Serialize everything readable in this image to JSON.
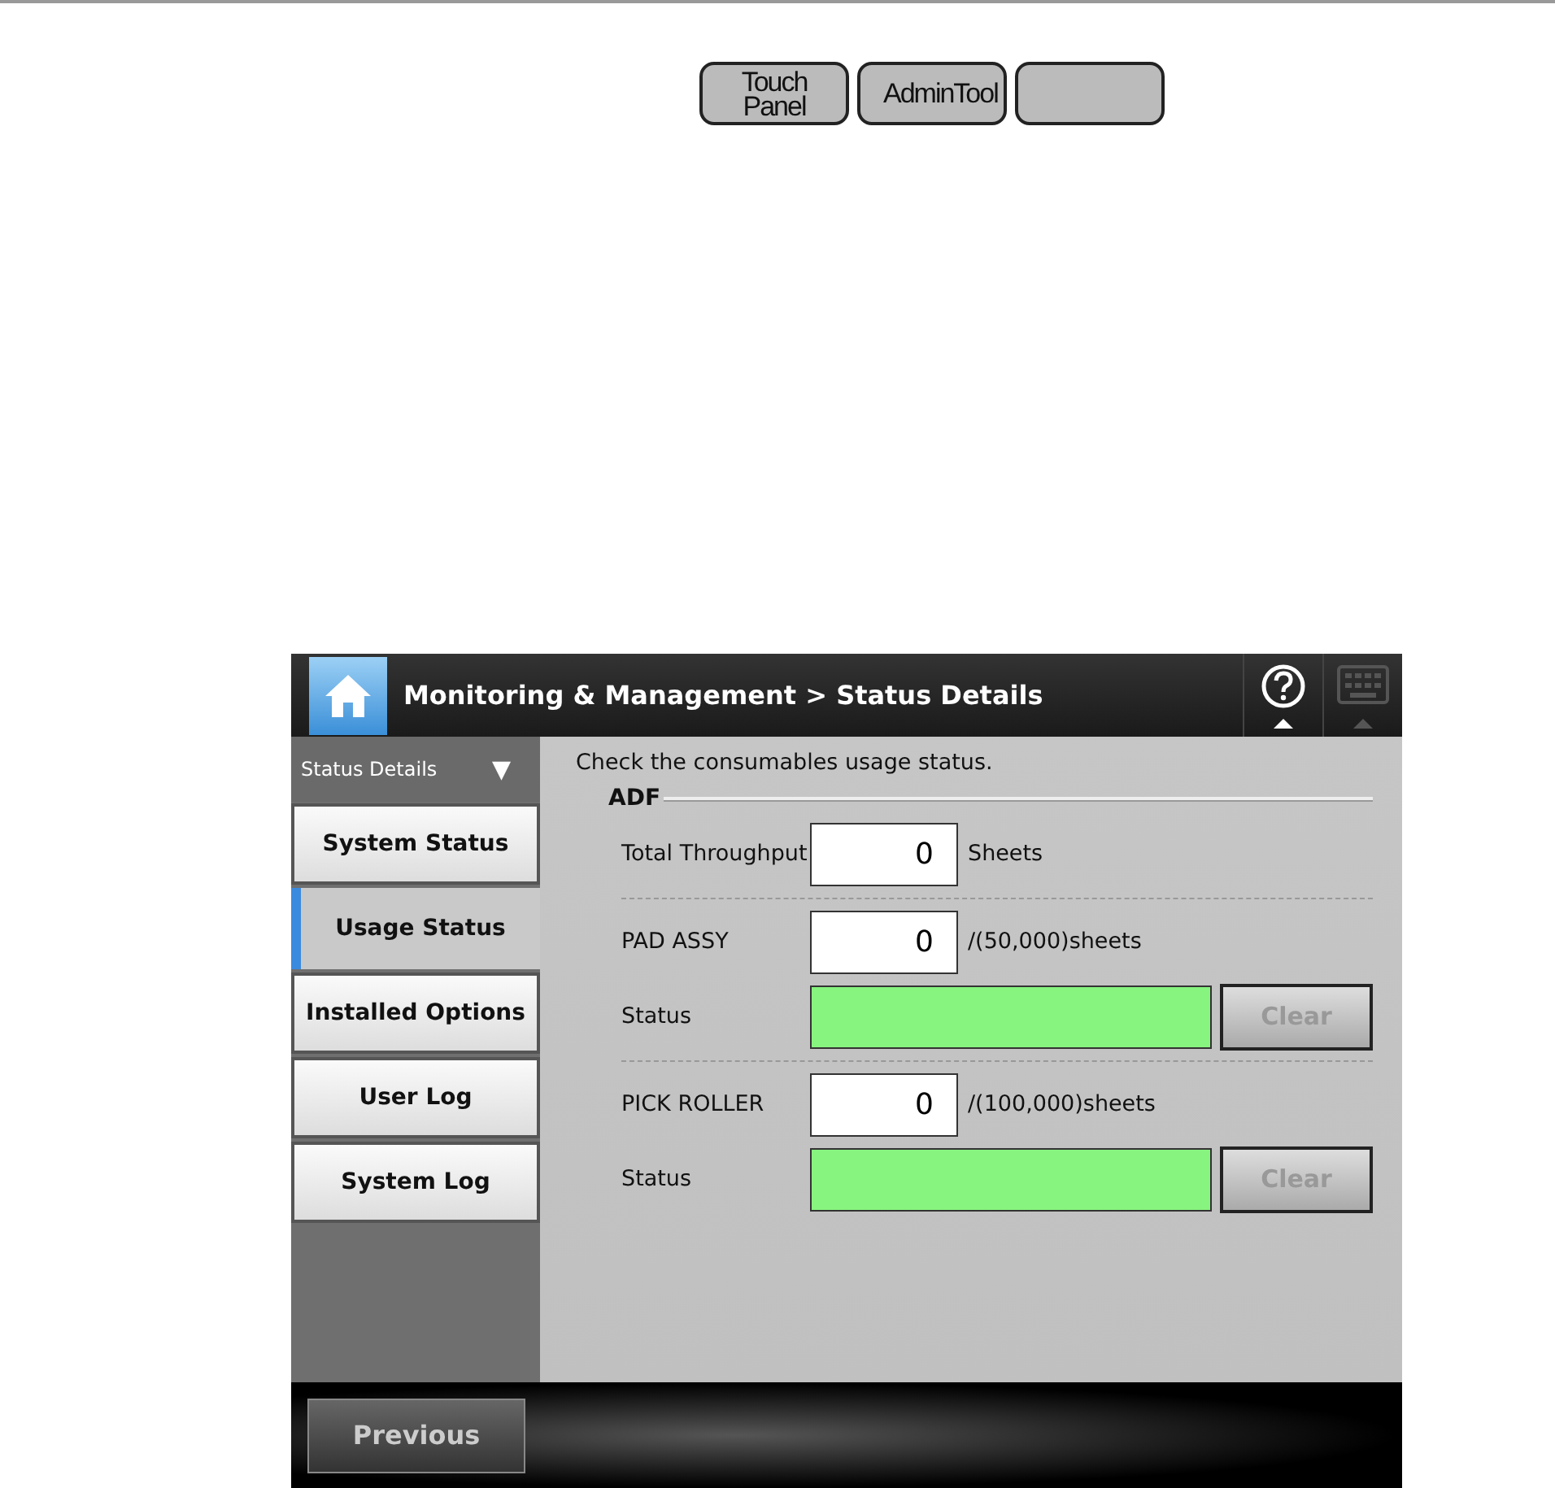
{
  "top_buttons": [
    {
      "kind": "text",
      "label": "Touch Panel"
    },
    {
      "kind": "text",
      "label": "AdminTool"
    },
    {
      "kind": "blank"
    }
  ],
  "screen": {
    "title": "Monitoring & Management > Status Details",
    "sidebar": {
      "heading": "Status Details",
      "caret": "▼",
      "items": [
        {
          "label": "System Status",
          "selected": false
        },
        {
          "label": "Usage Status",
          "selected": true
        },
        {
          "label": "Installed Options",
          "selected": false
        },
        {
          "label": "User Log",
          "selected": false
        },
        {
          "label": "System Log",
          "selected": false
        }
      ]
    },
    "description": "Check the consumables usage status.",
    "section": "ADF",
    "rows": [
      {
        "kind": "counter",
        "label": "Total Throughput",
        "value": "0",
        "unit": "Sheets"
      },
      {
        "kind": "divider"
      },
      {
        "kind": "counter",
        "label": "PAD ASSY",
        "value": "0",
        "unit": "/(50,000)sheets"
      },
      {
        "kind": "status",
        "label": "Status",
        "color": "#87f47f",
        "button": "Clear",
        "disabled": true
      },
      {
        "kind": "divider"
      },
      {
        "kind": "counter",
        "label": "PICK ROLLER",
        "value": "0",
        "unit": "/(100,000)sheets"
      },
      {
        "kind": "status",
        "label": "Status",
        "color": "#87f47f",
        "button": "Clear",
        "disabled": true
      }
    ],
    "footer": {
      "button": "Previous"
    }
  }
}
